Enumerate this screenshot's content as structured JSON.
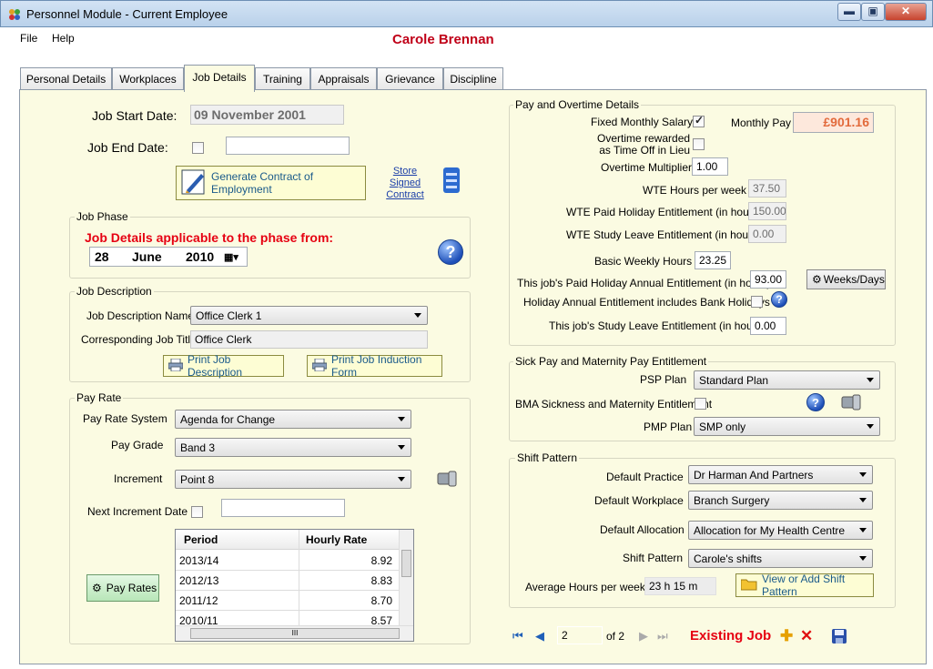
{
  "window": {
    "title": "Personnel Module - Current Employee",
    "min": "▬",
    "max": "▣",
    "close": "✕"
  },
  "menu": {
    "file": "File",
    "help": "Help"
  },
  "employee_name": "Carole Brennan",
  "tabs": [
    "Personal Details",
    "Workplaces",
    "Job Details",
    "Training",
    "Appraisals",
    "Grievance",
    "Discipline"
  ],
  "job": {
    "start_label": "Job Start Date:",
    "start_value": "09 November 2001",
    "end_label": "Job End Date:",
    "end_value": "",
    "generate_btn": "Generate Contract of Employment",
    "store_link": "Store Signed Contract"
  },
  "phase": {
    "group": "Job Phase",
    "heading": "Job Details applicable to the phase from:",
    "day": "28",
    "month": "June",
    "year": "2010"
  },
  "desc": {
    "group": "Job Description",
    "name_label": "Job Description Name",
    "name_value": "Office Clerk 1",
    "title_label": "Corresponding Job Title",
    "title_value": "Office Clerk",
    "print_desc": "Print Job Description",
    "print_induction": "Print Job Induction Form"
  },
  "payrate": {
    "group": "Pay Rate",
    "system_label": "Pay Rate System",
    "system_value": "Agenda for Change",
    "grade_label": "Pay Grade",
    "grade_value": "Band 3",
    "inc_label": "Increment",
    "inc_value": "Point 8",
    "next_label": "Next Increment Date",
    "next_value": "",
    "pay_rates_btn": "Pay Rates",
    "table": {
      "headers": [
        "Period",
        "Hourly Rate"
      ],
      "rows": [
        [
          "2013/14",
          "8.92"
        ],
        [
          "2012/13",
          "8.83"
        ],
        [
          "2011/12",
          "8.70"
        ],
        [
          "2010/11",
          "8.57"
        ]
      ]
    }
  },
  "payot": {
    "group": "Pay and Overtime Details",
    "fixed_label": "Fixed Monthly Salary",
    "fixed_checked": true,
    "monthly_label": "Monthly Pay",
    "monthly_value": "£901.16",
    "ot_time_off_label1": "Overtime rewarded",
    "ot_time_off_label2": "as Time Off in Lieu",
    "ot_mult_label": "Overtime Multiplier",
    "ot_mult_value": "1.00",
    "wte_hours_label": "WTE Hours per week",
    "wte_hours_value": "37.50",
    "wte_hol_label": "WTE Paid Holiday Entitlement (in hours)",
    "wte_hol_value": "150.00",
    "wte_study_label": "WTE Study Leave Entitlement (in hours)",
    "wte_study_value": "0.00",
    "basic_label": "Basic Weekly Hours",
    "basic_value": "23.25",
    "paid_hol_label": "This job's Paid Holiday Annual Entitlement  (in hours)",
    "paid_hol_value": "93.00",
    "weeks_days_btn": "Weeks/Days",
    "bank_label": "Holiday Annual Entitlement includes Bank Holidays",
    "study_label": "This job's Study Leave Entitlement (in hours)",
    "study_value": "0.00"
  },
  "sick": {
    "group": "Sick Pay and Maternity Pay Entitlement",
    "psp_label": "PSP Plan",
    "psp_value": "Standard Plan",
    "bma_label": "BMA Sickness and Maternity Entitlement",
    "pmp_label": "PMP Plan",
    "pmp_value": "SMP only"
  },
  "shift": {
    "group": "Shift Pattern",
    "practice_label": "Default Practice",
    "practice_value": "Dr Harman And Partners",
    "workplace_label": "Default Workplace",
    "workplace_value": "Branch Surgery",
    "alloc_label": "Default Allocation",
    "alloc_value": "Allocation for My Health Centre",
    "pattern_label": "Shift Pattern",
    "pattern_value": "Carole's shifts",
    "avg_label": "Average Hours per week",
    "avg_value": "23 h  15 m",
    "view_btn": "View or Add Shift Pattern"
  },
  "nav": {
    "current": "2",
    "of": "of 2",
    "status": "Existing Job"
  },
  "help_glyph": "?",
  "icons": {
    "grid_scroll": "III"
  }
}
